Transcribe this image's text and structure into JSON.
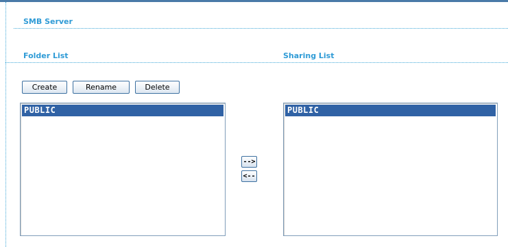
{
  "title": "SMB Server",
  "folder_list": {
    "heading": "Folder List",
    "items": [
      "PUBLIC"
    ]
  },
  "sharing_list": {
    "heading": "Sharing List",
    "items": [
      "PUBLIC"
    ]
  },
  "buttons": {
    "create": "Create",
    "rename": "Rename",
    "delete": "Delete",
    "add": "-->",
    "remove": "<--"
  },
  "colors": {
    "heading": "#2f9bd6",
    "selection": "#3062a5",
    "header_rule": "#4a7aa8"
  }
}
